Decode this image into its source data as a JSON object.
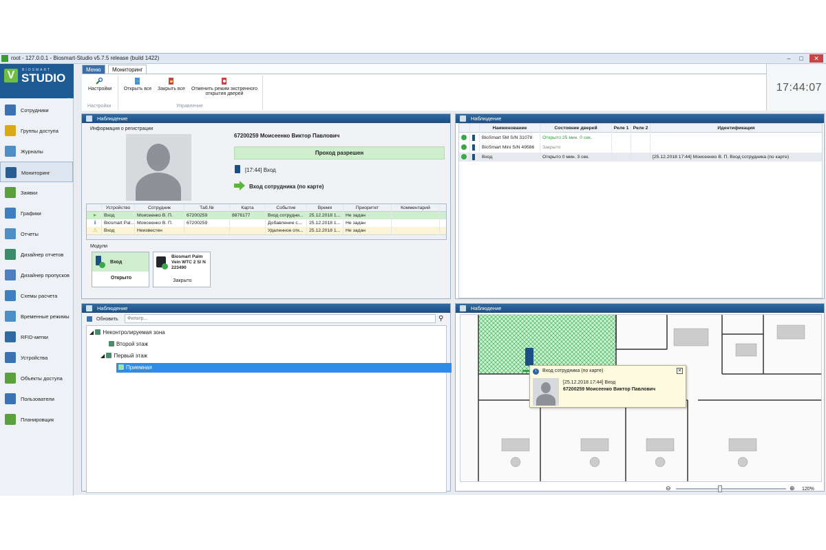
{
  "window": {
    "title": "root - 127.0.0.1 - Biosmart-Studio v5.7.5 release (build 1422)"
  },
  "brand": {
    "small": "BIOSMART",
    "name": "STUDIO",
    "logo_letter": "V",
    "user": "root"
  },
  "sidebar": {
    "items": [
      {
        "label": "Сотрудники",
        "icon": "employees-icon",
        "color": "#3a72b3"
      },
      {
        "label": "Группы доступа",
        "icon": "lock-group-icon",
        "color": "#d9a81b"
      },
      {
        "label": "Журналы",
        "icon": "journal-icon",
        "color": "#4d8fc9"
      },
      {
        "label": "Мониторинг",
        "icon": "monitoring-icon",
        "color": "#2b5c8f"
      },
      {
        "label": "Заявки",
        "icon": "requests-icon",
        "color": "#5aa03e"
      },
      {
        "label": "Графики",
        "icon": "schedules-icon",
        "color": "#3e7fc2"
      },
      {
        "label": "Отчеты",
        "icon": "reports-icon",
        "color": "#4d8fc9"
      },
      {
        "label": "Дизайнер отчетов",
        "icon": "report-designer-icon",
        "color": "#3b8c68"
      },
      {
        "label": "Дизайнер пропусков",
        "icon": "pass-designer-icon",
        "color": "#4c7fbf"
      },
      {
        "label": "Схемы расчета",
        "icon": "calc-scheme-icon",
        "color": "#3e7fc2"
      },
      {
        "label": "Временные режимы",
        "icon": "time-modes-icon",
        "color": "#4d8fc9"
      },
      {
        "label": "RFID-метки",
        "icon": "rfid-icon",
        "color": "#2f6aa3"
      },
      {
        "label": "Устройства",
        "icon": "devices-icon",
        "color": "#3a72b3"
      },
      {
        "label": "Объекты доступа",
        "icon": "access-objects-icon",
        "color": "#5aa03e"
      },
      {
        "label": "Пользователи",
        "icon": "users-icon",
        "color": "#3a72b3"
      },
      {
        "label": "Планировщик",
        "icon": "scheduler-icon",
        "color": "#5aa03e"
      }
    ]
  },
  "ribbon": {
    "tabs": [
      "Меню",
      "Мониторинг"
    ],
    "settings": "Настройки",
    "open_all": "Открыть все",
    "close_all": "Закрыть все",
    "cancel_emergency": "Отменить режим экстренного",
    "cancel_emergency2": "открытия дверей",
    "group_settings": "Настройки",
    "group_control": "Управление"
  },
  "clock": "17:44:07",
  "panel_titles": {
    "p1": "Наблюдение",
    "p2": "Наблюдение",
    "p3": "Наблюдение",
    "p4": "Наблюдение"
  },
  "registration": {
    "section": "Информация о регистрации",
    "person": "67200259 Моисеенко Виктор Павлович",
    "status": "Проход разрешен",
    "event_time": "[17:44] Вход",
    "event_desc": "Вход сотрудника (по карте)",
    "columns": [
      "Устройство",
      "Сотрудник",
      "Таб.№",
      "Карта",
      "Событие",
      "Время",
      "Приоритет",
      "Комментарий"
    ],
    "rows": [
      [
        "Вход",
        "Моисеенко В. П.",
        "67200259",
        "8876177",
        "Вход сотрудни...",
        "25.12.2018 1...",
        "Не задан",
        ""
      ],
      [
        "Biosmart Pal...",
        "Моисеенко В. П.",
        "67200259",
        "",
        "Добавление с...",
        "25.12.2018 1...",
        "Не задан",
        ""
      ],
      [
        "Вход",
        "Неизвестен",
        "",
        "",
        "Удаленное отк...",
        "25.12.2018 1...",
        "Не задан",
        ""
      ]
    ],
    "modules_label": "Модули",
    "module1_name": "Вход",
    "module1_state": "Открыто",
    "module2_name": "Biosmart Palm Vein WTC 2 S/ N 223490",
    "module2_state": "Закрыто"
  },
  "devices": {
    "columns": [
      "Наименование",
      "Состояние дверей",
      "Реле 1",
      "Реле 2",
      "Идентификация"
    ],
    "rows": [
      [
        "BioSmart 5M S/N 31078",
        "Открыто 25 мин. 0 сек.",
        "",
        "",
        ""
      ],
      [
        "BioSmart Mini S/N 49586",
        "Закрыто",
        "",
        "",
        ""
      ],
      [
        "Вход",
        "Открыто 0 мин. 3 сек.",
        "",
        "",
        "[25.12.2018 17:44] Моисеенко В. П. Вход сотрудника (по карте)"
      ]
    ]
  },
  "zones": {
    "refresh": "Обновить",
    "filter_placeholder": "Фильтр...",
    "tree": [
      "Неконтролируемая зона",
      "Второй этаж",
      "Первый этаж",
      "Приемная"
    ]
  },
  "map": {
    "popup_title": "Вход сотрудника (по карте)",
    "popup_line1": "[25.12.2018 17:44] Вход",
    "popup_line2": "67200259 Моисеенко Виктор Павлович",
    "zoom": "120%",
    "zoom_fraction": 0.4
  }
}
